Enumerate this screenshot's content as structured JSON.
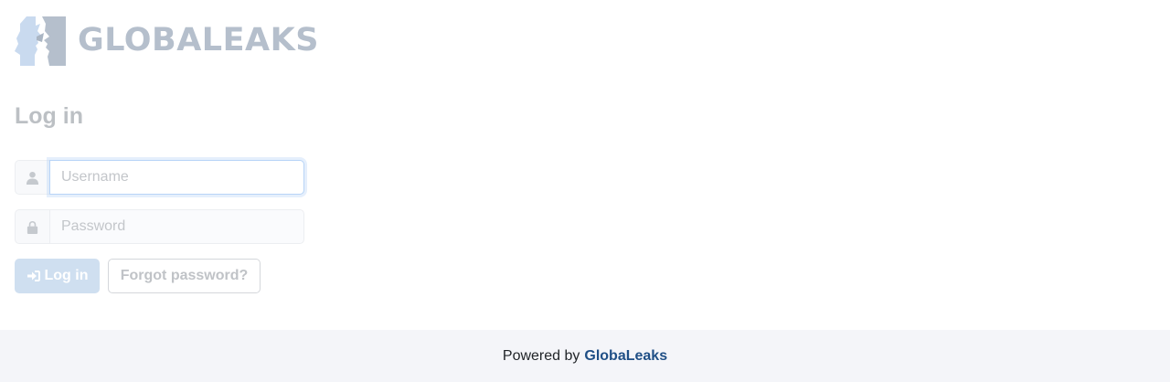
{
  "header": {
    "logo_text": "GLOBALEAKS",
    "logo_icon": "globaleaks-faces-logo"
  },
  "login": {
    "title": "Log in",
    "username": {
      "placeholder": "Username",
      "value": "",
      "icon": "user-icon"
    },
    "password": {
      "placeholder": "Password",
      "value": "",
      "icon": "lock-icon"
    },
    "login_button": {
      "label": "Log in",
      "icon": "sign-in-icon"
    },
    "forgot_button": {
      "label": "Forgot password?"
    }
  },
  "footer": {
    "prefix": "Powered by",
    "brand": "GlobaLeaks"
  },
  "colors": {
    "brand_link": "#1f4f86",
    "primary_disabled": "#cfdff0",
    "logo_gray": "#b5bfcc",
    "logo_blue": "#c9daef",
    "footer_bg": "#f4f5f9"
  }
}
